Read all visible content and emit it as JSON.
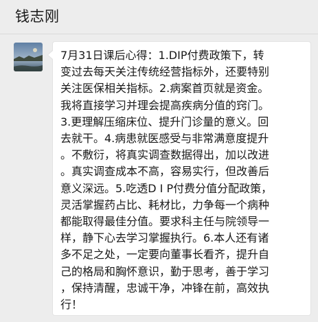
{
  "header": {
    "title": "钱志刚"
  },
  "message": {
    "avatar": "sender-avatar-landscape",
    "text": "7月31日课后心得：1.DIP付费政策下，转\n变过去每天关注传统经营指标外，还要特别\n关注医保相关指标。2.病案首页就是资金。\n我将直接学习并理会提高疾病分值的窍门。\n3.更理解压缩床位、提升门诊量的意义。回\n去就干。4.病患就医感受与非常满意度提升\n。不敷衍，将真实调查数据得出，加以改进\n。真实调查成本不高，容易实行，但改善后\n意义深远。5.吃透D I P付费分值分配政策，\n灵活掌握药占比、耗材比，力争每一个病种\n都能取得最佳分值。要求科主任与院领导一\n样，静下心去学习掌握执行。6.本人还有诸\n多不足之处，一定要向董事长看齐，提升自\n己的格局和胸怀意识，勤于思考，善于学习\n，保持清醒，忠诚干净，冲锋在前，高效执\n行！"
  },
  "colors": {
    "background": "#ededed",
    "bubble": "#ffffff",
    "text": "#191919"
  }
}
